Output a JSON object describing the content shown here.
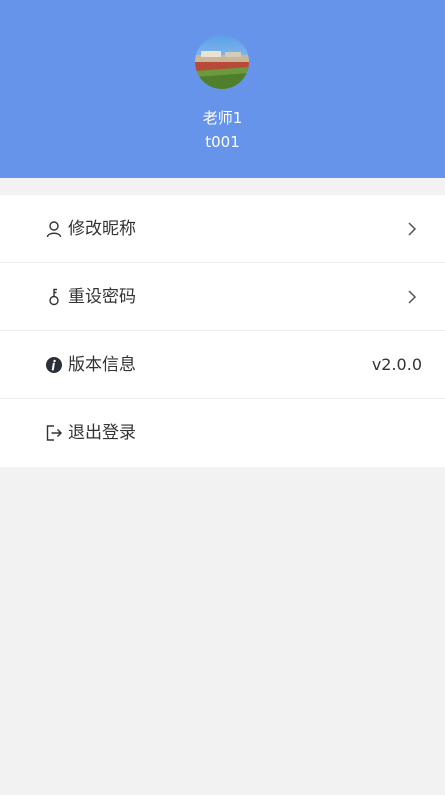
{
  "header": {
    "name": "老师1",
    "user_id": "t001",
    "background_color": "#6694ea"
  },
  "menu": {
    "items": [
      {
        "label": "修改昵称",
        "icon": "user-icon",
        "trailing": "chevron-right-icon"
      },
      {
        "label": "重设密码",
        "icon": "key-icon",
        "trailing": "chevron-right-icon"
      },
      {
        "label": "版本信息",
        "icon": "info-icon",
        "value": "v2.0.0"
      },
      {
        "label": "退出登录",
        "icon": "logout-icon"
      }
    ]
  }
}
